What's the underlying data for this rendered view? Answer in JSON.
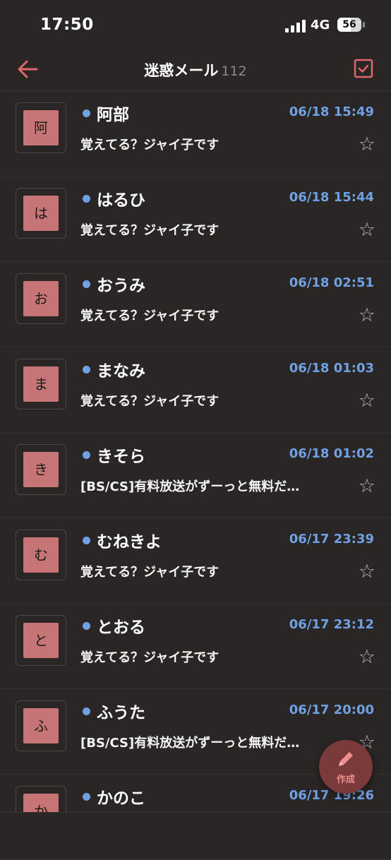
{
  "status_bar": {
    "time": "17:50",
    "network": "4G",
    "battery": "56",
    "battery_level": 0.56
  },
  "header": {
    "back_icon": "arrow-left-icon",
    "title": "迷惑メール",
    "count": "112",
    "select_icon": "checkbox-icon"
  },
  "colors": {
    "accent": "#e0676a",
    "unread": "#70a1e3",
    "avatar": "#c67476",
    "background": "#2a2625"
  },
  "messages": [
    {
      "initial": "阿",
      "sender": "阿部",
      "date": "06/18 15:49",
      "subject": "覚えてる？ジャイ子です"
    },
    {
      "initial": "は",
      "sender": "はるひ",
      "date": "06/18 15:44",
      "subject": "覚えてる？ジャイ子です"
    },
    {
      "initial": "お",
      "sender": "おうみ",
      "date": "06/18 02:51",
      "subject": "覚えてる？ジャイ子です"
    },
    {
      "initial": "ま",
      "sender": "まなみ",
      "date": "06/18 01:03",
      "subject": "覚えてる？ジャイ子です"
    },
    {
      "initial": "き",
      "sender": "きそら",
      "date": "06/18 01:02",
      "subject": "[BS/CS]有料放送がずーっと無料だ…"
    },
    {
      "initial": "む",
      "sender": "むねきよ",
      "date": "06/17 23:39",
      "subject": "覚えてる？ジャイ子です"
    },
    {
      "initial": "と",
      "sender": "とおる",
      "date": "06/17 23:12",
      "subject": "覚えてる？ジャイ子です"
    },
    {
      "initial": "ふ",
      "sender": "ふうた",
      "date": "06/17 20:00",
      "subject": "[BS/CS]有料放送がずーっと無料だ…"
    },
    {
      "initial": "か",
      "sender": "かのこ",
      "date": "06/17 19:26",
      "subject": ""
    }
  ],
  "fab": {
    "icon": "pencil-icon",
    "label": "作成"
  }
}
